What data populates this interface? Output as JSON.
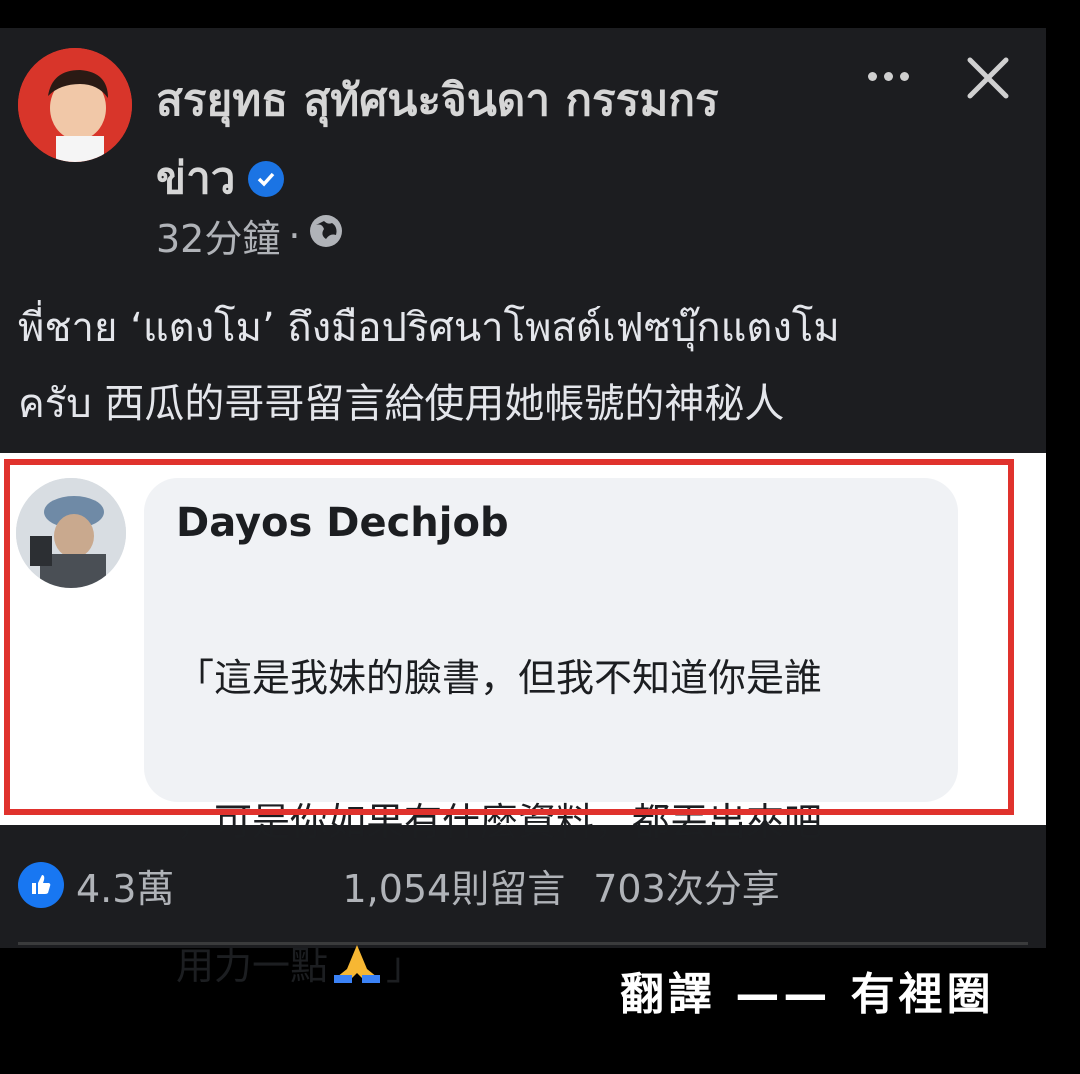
{
  "post": {
    "author_line1": "สรยุทธ สุทัศนะจินดา กรรมกร",
    "author_line2": "ข่าว",
    "time": "32分鐘",
    "separator": "·",
    "text_line1": "พี่ชาย ‘แตงโม’ ถึงมือปริศนาโพสต์เฟซบุ๊กแตงโม",
    "text_line2": "ครับ 西瓜的哥哥留言給使用她帳號的神秘人"
  },
  "comment": {
    "name": "Dayos Dechjob",
    "line1": "「這是我妹的臉書，但我不知道你是誰",
    "line2": "，可是你如果有什麼資料，都丟出來吧",
    "line3_text": "用力一點",
    "line3_end": "」"
  },
  "stats": {
    "likes": "4.3萬",
    "comments": "1,054則留言",
    "shares": "703次分享"
  },
  "cut_text": "翻譯 —— 有裡圈",
  "icons": {
    "verified": "verified-badge-icon",
    "globe": "globe-icon",
    "more": "more-icon",
    "close": "close-icon",
    "like": "like-icon",
    "pray": "praying-hands-emoji"
  },
  "colors": {
    "post_bg": "#1c1d20",
    "highlight_border": "#e0322d",
    "like_blue": "#1877f2"
  }
}
